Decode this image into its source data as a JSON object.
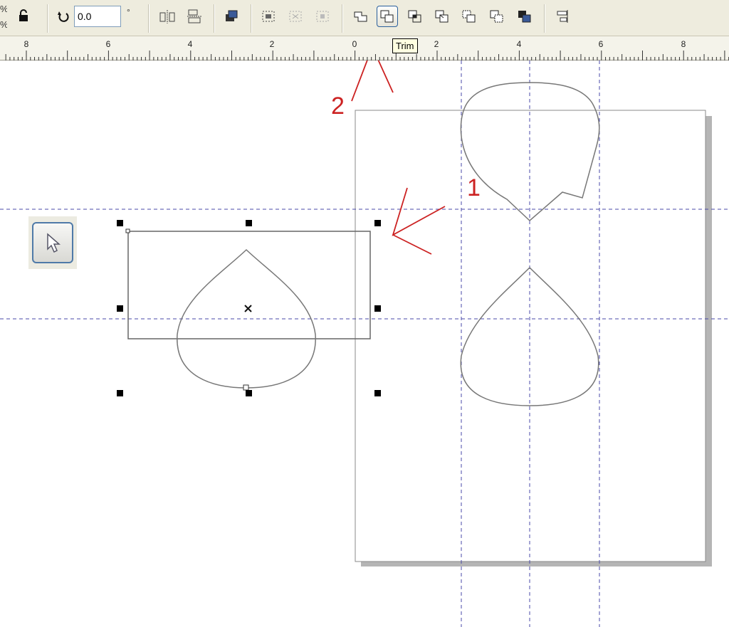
{
  "toolbar": {
    "rotation_value": "0.0",
    "degree_symbol": "°"
  },
  "ruler": {
    "labels": [
      "8",
      "6",
      "4",
      "2",
      "0",
      "2",
      "4",
      "6",
      "8"
    ]
  },
  "tooltip": {
    "text": "Trim"
  },
  "annotations": {
    "one": "1",
    "two": "2"
  },
  "colors": {
    "annotation": "#cc2222",
    "guide": "#4a4aa8",
    "active_border": "#2a5f9c"
  }
}
